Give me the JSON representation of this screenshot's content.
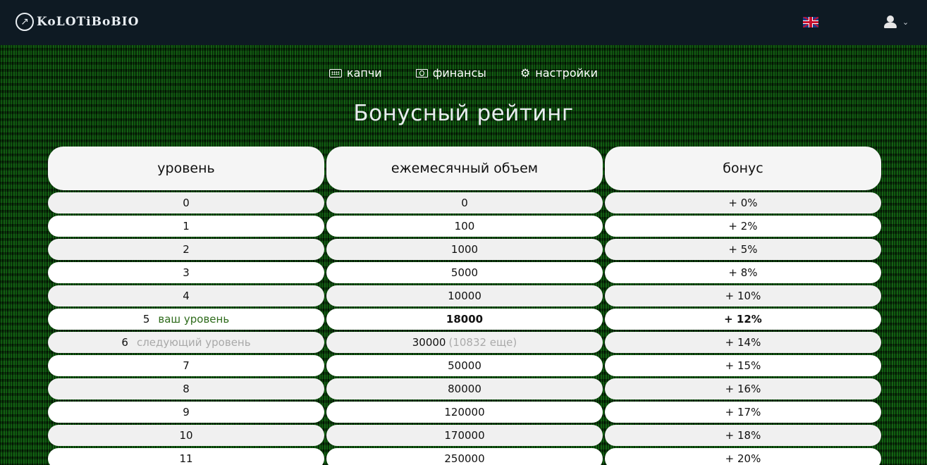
{
  "header": {
    "brand": "KoLOTiBoBIO",
    "language_flag": "uk-flag-icon",
    "user_menu_icon": "user-icon"
  },
  "nav": {
    "items": [
      {
        "label": "капчи",
        "icon": "keyboard-icon"
      },
      {
        "label": "финансы",
        "icon": "money-icon"
      },
      {
        "label": "настройки",
        "icon": "gear-icon"
      }
    ]
  },
  "page": {
    "title": "Бонусный рейтинг"
  },
  "table": {
    "headers": [
      "уровень",
      "ежемесячный объем",
      "бонус"
    ],
    "current_label": "ваш уровень",
    "next_label": "следующий уровень",
    "rows": [
      {
        "level": "0",
        "volume": "0",
        "bonus": "+ 0%"
      },
      {
        "level": "1",
        "volume": "100",
        "bonus": "+ 2%"
      },
      {
        "level": "2",
        "volume": "1000",
        "bonus": "+ 5%"
      },
      {
        "level": "3",
        "volume": "5000",
        "bonus": "+ 8%"
      },
      {
        "level": "4",
        "volume": "10000",
        "bonus": "+ 10%"
      },
      {
        "level": "5",
        "volume": "18000",
        "bonus": "+ 12%"
      },
      {
        "level": "6",
        "volume": "30000",
        "volume_note": "(10832 еще)",
        "bonus": "+ 14%"
      },
      {
        "level": "7",
        "volume": "50000",
        "bonus": "+ 15%"
      },
      {
        "level": "8",
        "volume": "80000",
        "bonus": "+ 16%"
      },
      {
        "level": "9",
        "volume": "120000",
        "bonus": "+ 17%"
      },
      {
        "level": "10",
        "volume": "170000",
        "bonus": "+ 18%"
      },
      {
        "level": "11",
        "volume": "250000",
        "bonus": "+ 20%"
      }
    ]
  },
  "colors": {
    "topbar": "#0e1a23",
    "current_level_tag": "#2e6b1b",
    "next_level_tag": "#a9a9a9"
  }
}
